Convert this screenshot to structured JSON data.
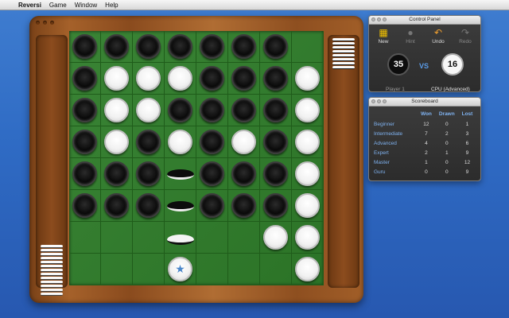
{
  "menubar": {
    "apple": "",
    "app_name": "Reversi",
    "items": [
      "Game",
      "Window",
      "Help"
    ]
  },
  "board": {
    "rows": [
      [
        "B",
        "B",
        "B",
        "B",
        "B",
        "B",
        "B",
        "E"
      ],
      [
        "B",
        "W",
        "W",
        "W",
        "B",
        "B",
        "B",
        "W"
      ],
      [
        "B",
        "W",
        "W",
        "B",
        "B",
        "B",
        "B",
        "W"
      ],
      [
        "B",
        "W",
        "B",
        "W",
        "B",
        "W",
        "B",
        "W"
      ],
      [
        "B",
        "B",
        "B",
        "B",
        "B",
        "B",
        "B",
        "W"
      ],
      [
        "B",
        "B",
        "B",
        "B",
        "B",
        "B",
        "B",
        "W"
      ],
      [
        "E",
        "E",
        "E",
        "E",
        "E",
        "E",
        "W",
        "W"
      ],
      [
        "E",
        "E",
        "E",
        "E",
        "E",
        "E",
        "E",
        "W"
      ]
    ],
    "flipping": [
      {
        "row": 4,
        "col": 3,
        "face": "black"
      },
      {
        "row": 5,
        "col": 3,
        "face": "black"
      },
      {
        "row": 6,
        "col": 3,
        "face": "white"
      }
    ],
    "hint": {
      "row": 7,
      "col": 3,
      "icon": "star-icon"
    }
  },
  "control_panel": {
    "title": "Control Panel",
    "tools": [
      {
        "label": "New",
        "icon": "new-game-icon",
        "enabled": true
      },
      {
        "label": "Hint",
        "icon": "lightbulb-icon",
        "enabled": false
      },
      {
        "label": "Undo",
        "icon": "undo-arrow-icon",
        "enabled": true
      },
      {
        "label": "Redo",
        "icon": "redo-arrow-icon",
        "enabled": false
      }
    ],
    "player1": {
      "score": "35",
      "name": "Player 1"
    },
    "vs": "VS",
    "player2": {
      "score": "16",
      "name": "CPU (Advanced)"
    }
  },
  "scoreboard": {
    "title": "Scoreboard",
    "columns": [
      "Won",
      "Drawn",
      "Lost"
    ],
    "rows": [
      {
        "level": "Beginner",
        "won": "12",
        "drawn": "0",
        "lost": "1"
      },
      {
        "level": "Intermediate",
        "won": "7",
        "drawn": "2",
        "lost": "3"
      },
      {
        "level": "Advanced",
        "won": "4",
        "drawn": "0",
        "lost": "6"
      },
      {
        "level": "Expert",
        "won": "2",
        "drawn": "1",
        "lost": "9"
      },
      {
        "level": "Master",
        "won": "1",
        "drawn": "0",
        "lost": "12"
      },
      {
        "level": "Guru",
        "won": "0",
        "drawn": "0",
        "lost": "9"
      }
    ]
  },
  "colors": {
    "accent": "#5a9be6",
    "felt": "#2f7d2a",
    "wood": "#a5612a"
  }
}
